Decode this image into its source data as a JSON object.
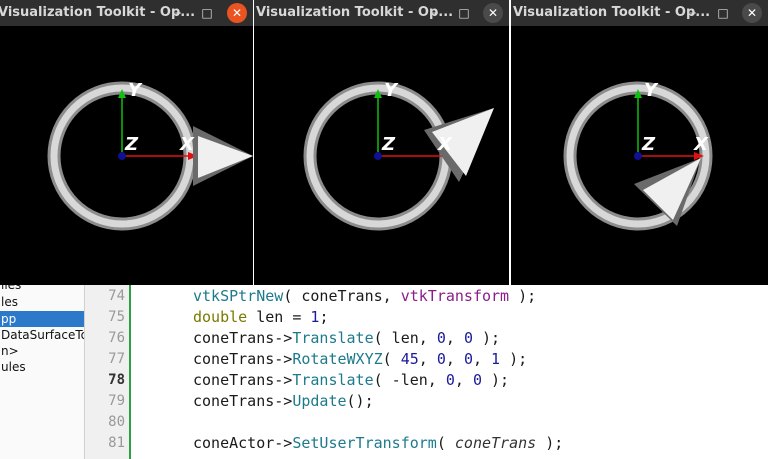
{
  "windows": [
    {
      "title": "Visualization Toolkit - Op...",
      "minimize": "–",
      "maximize": "□",
      "close": "✕",
      "active": true
    },
    {
      "title": "Visualization Toolkit - Op...",
      "minimize": "–",
      "maximize": "□",
      "close": "✕",
      "active": false
    },
    {
      "title": "Visualization Toolkit - Op...",
      "minimize": "–",
      "maximize": "□",
      "close": "✕",
      "active": false
    }
  ],
  "axes": {
    "x": "X",
    "y": "Y",
    "z": "Z"
  },
  "colors": {
    "titlebar": "#2f2f2f",
    "close_active": "#e95420",
    "close_inactive": "#4a4a4a",
    "x_axis": "#e01010",
    "y_axis": "#10c010",
    "z_axis": "#101090",
    "ring": "#c8c8c8",
    "selection": "#2c79c9",
    "gutter_marker": "#2ea043"
  },
  "sidebar": {
    "items": [
      {
        "label": "iles",
        "selected": false
      },
      {
        "label": "les",
        "selected": false
      },
      {
        "label": "pp",
        "selected": true
      },
      {
        "label": "DataSurfaceToP",
        "selected": false
      },
      {
        "label": "n>",
        "selected": false
      },
      {
        "label": "ules",
        "selected": false
      }
    ]
  },
  "editor": {
    "current_line": "78",
    "lines": [
      {
        "num": "74",
        "parts": [
          "",
          "vtkSPtrNew",
          "( coneTrans, ",
          "vtkTransform",
          " );"
        ]
      },
      {
        "num": "75",
        "parts": [
          "double",
          " len = ",
          "1",
          ";"
        ]
      },
      {
        "num": "76",
        "parts": [
          "coneTrans->",
          "Translate",
          "( len, ",
          "0",
          ", ",
          "0",
          " );"
        ]
      },
      {
        "num": "77",
        "parts": [
          "coneTrans->",
          "RotateWXYZ",
          "( ",
          "45",
          ", ",
          "0",
          ", ",
          "0",
          ", ",
          "1",
          " );"
        ]
      },
      {
        "num": "78",
        "parts": [
          "coneTrans->",
          "Translate",
          "( -len, ",
          "0",
          ", ",
          "0",
          " );"
        ]
      },
      {
        "num": "79",
        "parts": [
          "coneTrans->",
          "Update",
          "();"
        ]
      },
      {
        "num": "80",
        "parts": []
      },
      {
        "num": "81",
        "parts": [
          "coneActor->",
          "SetUserTransform",
          "( ",
          "coneTrans",
          " );"
        ]
      }
    ]
  }
}
